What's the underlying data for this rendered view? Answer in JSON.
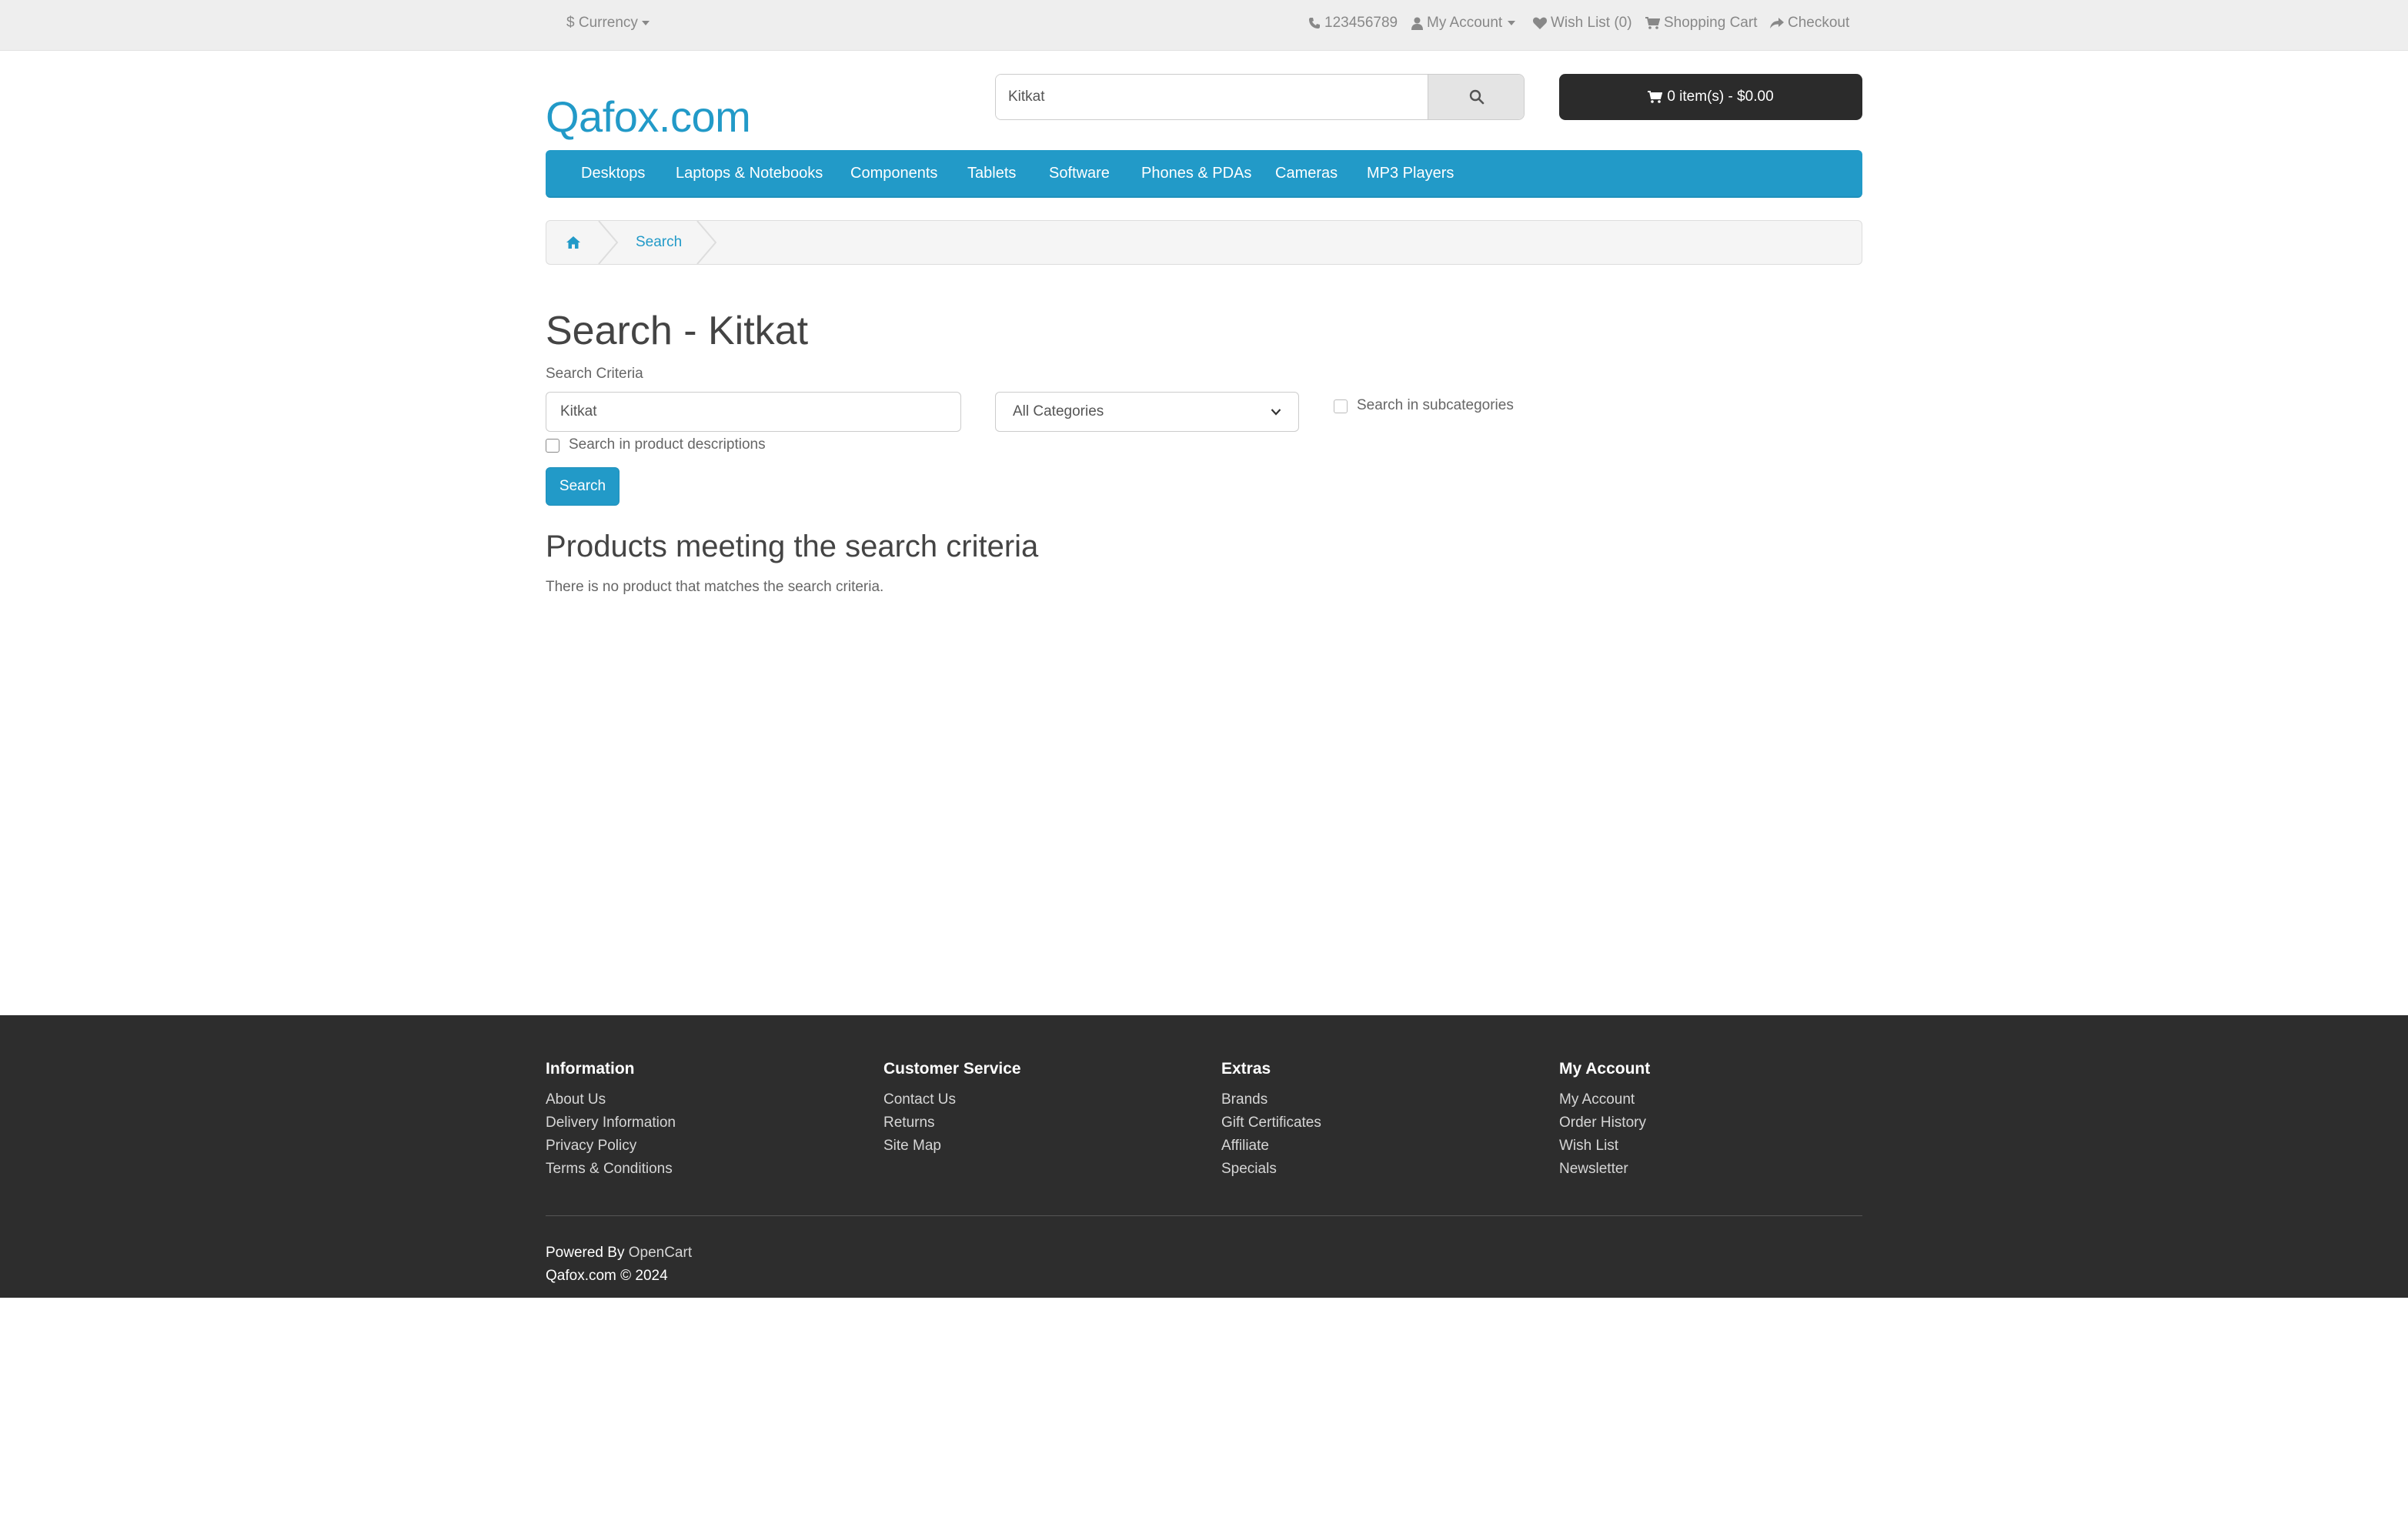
{
  "topbar": {
    "currency": "$ Currency",
    "phone": "123456789",
    "my_account": "My Account",
    "wish_list": "Wish List (0)",
    "shopping_cart": "Shopping Cart",
    "checkout": "Checkout"
  },
  "header": {
    "logo": "Qafox.com",
    "search_value": "Kitkat",
    "cart_label": "0 item(s) - $0.00"
  },
  "menu": {
    "items": [
      "Desktops",
      "Laptops & Notebooks",
      "Components",
      "Tablets",
      "Software",
      "Phones & PDAs",
      "Cameras",
      "MP3 Players"
    ]
  },
  "breadcrumb": {
    "current": "Search"
  },
  "main": {
    "title": "Search - Kitkat",
    "criteria_label": "Search Criteria",
    "keyword_value": "Kitkat",
    "category_selected": "All Categories",
    "subcategories_label": "Search in subcategories",
    "descriptions_label": "Search in product descriptions",
    "search_button": "Search",
    "results_heading": "Products meeting the search criteria",
    "no_results": "There is no product that matches the search criteria."
  },
  "footer": {
    "columns": [
      {
        "title": "Information",
        "links": [
          "About Us",
          "Delivery Information",
          "Privacy Policy",
          "Terms & Conditions"
        ]
      },
      {
        "title": "Customer Service",
        "links": [
          "Contact Us",
          "Returns",
          "Site Map"
        ]
      },
      {
        "title": "Extras",
        "links": [
          "Brands",
          "Gift Certificates",
          "Affiliate",
          "Specials"
        ]
      },
      {
        "title": "My Account",
        "links": [
          "My Account",
          "Order History",
          "Wish List",
          "Newsletter"
        ]
      }
    ],
    "powered_prefix": "Powered By",
    "powered_link": "OpenCart",
    "copyright": "Qafox.com © 2024"
  },
  "colors": {
    "accent": "#229ac8",
    "dark": "#2d2d2d",
    "topbar_bg": "#eeeeee"
  },
  "icons": [
    "phone-icon",
    "user-icon",
    "heart-icon",
    "cart-icon",
    "share-icon",
    "search-icon",
    "home-icon",
    "caret-down-icon"
  ]
}
